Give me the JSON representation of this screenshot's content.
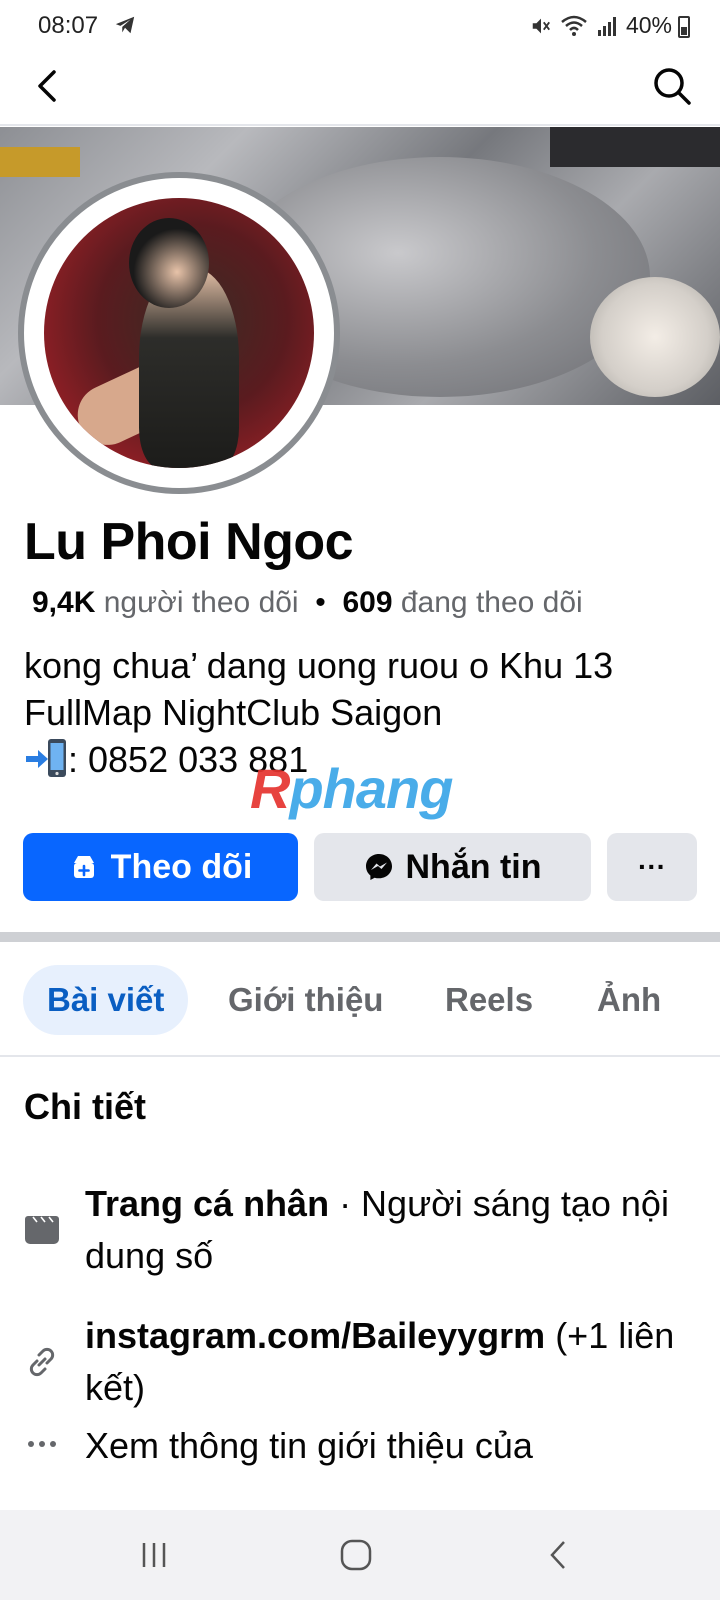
{
  "status_bar": {
    "time": "08:07",
    "battery": "40%"
  },
  "profile": {
    "name": "Lu Phoi Ngoc",
    "followers_count": "9,4K",
    "followers_label": "người theo dõi",
    "separator": "•",
    "following_count": "609",
    "following_label": "đang theo dõi",
    "bio_line1": "kong chua’ dang uong ruou o Khu 13",
    "bio_line2": "FullMap NightClub Saigon",
    "bio_line3": ": 0852 033 881"
  },
  "watermark": {
    "first": "R",
    "rest": "phang"
  },
  "actions": {
    "follow_label": "Theo dõi",
    "message_label": "Nhắn tin",
    "more_label": "···"
  },
  "tabs": [
    {
      "label": "Bài viết",
      "active": true
    },
    {
      "label": "Giới thiệu",
      "active": false
    },
    {
      "label": "Reels",
      "active": false
    },
    {
      "label": "Ảnh",
      "active": false
    }
  ],
  "details": {
    "title": "Chi tiết",
    "page_type_bold": "Trang cá nhân",
    "page_type_rest": " · Người sáng tạo nội dung số",
    "link_bold": "instagram.com/Baileyygrm",
    "link_rest": " (+1 liên kết)",
    "more_info": "Xem thông tin giới thiệu của"
  },
  "icons": {
    "back": "chevron-left-icon",
    "search": "search-icon",
    "page": "page-icon",
    "link": "link-icon",
    "more": "more-dots-icon"
  },
  "colors": {
    "primary": "#0866ff",
    "secondary_button": "#e4e6eb",
    "active_tab_bg": "#e7f0fd",
    "active_tab_text": "#0a5ec2"
  }
}
